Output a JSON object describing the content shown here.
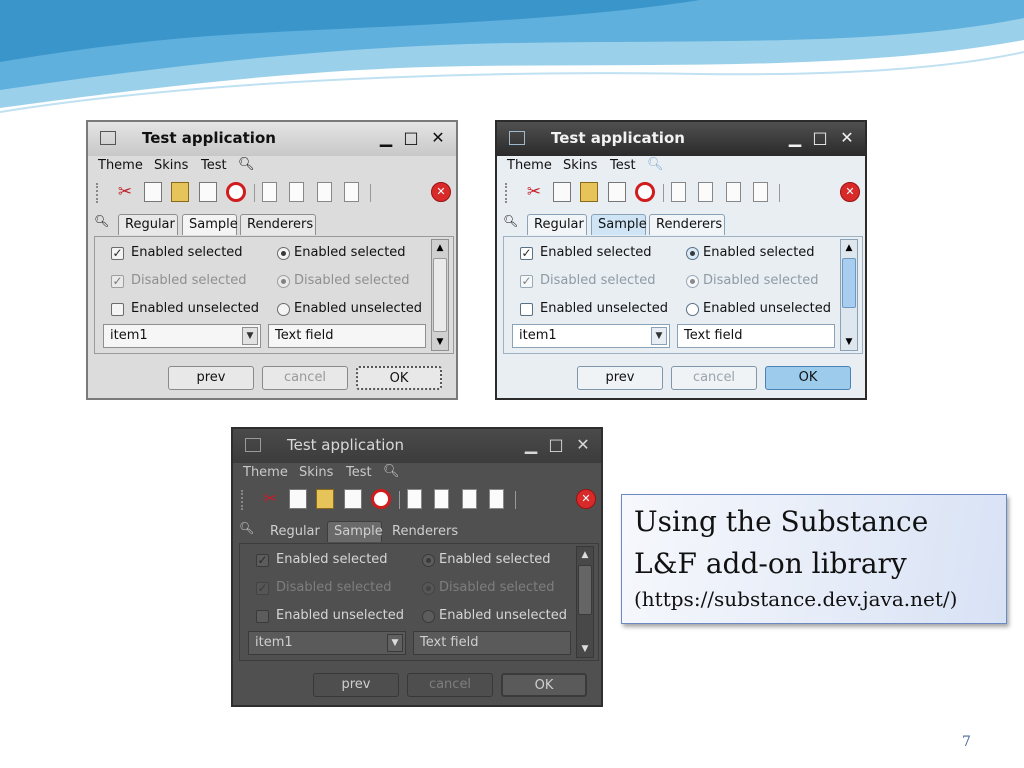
{
  "windows": [
    {
      "title": "Test application",
      "menu": [
        "Theme",
        "Skins",
        "Test"
      ],
      "tabs": [
        "Regular",
        "Sample",
        "Renderers"
      ],
      "check_enabled_selected": "Enabled selected",
      "check_disabled_selected": "Disabled selected",
      "check_enabled_unselected": "Enabled unselected",
      "radio_enabled_selected": "Enabled selected",
      "radio_disabled_selected": "Disabled selected",
      "radio_enabled_unselected": "Enabled unselected",
      "combo_value": "item1",
      "text_field": "Text field",
      "prev": "prev",
      "cancel": "cancel",
      "ok": "OK"
    },
    {
      "title": "Test application",
      "menu": [
        "Theme",
        "Skins",
        "Test"
      ],
      "tabs": [
        "Regular",
        "Sample",
        "Renderers"
      ],
      "check_enabled_selected": "Enabled selected",
      "check_disabled_selected": "Disabled selected",
      "check_enabled_unselected": "Enabled unselected",
      "radio_enabled_selected": "Enabled selected",
      "radio_disabled_selected": "Disabled selected",
      "radio_enabled_unselected": "Enabled unselected",
      "combo_value": "item1",
      "text_field": "Text field",
      "prev": "prev",
      "cancel": "cancel",
      "ok": "OK"
    },
    {
      "title": "Test application",
      "menu": [
        "Theme",
        "Skins",
        "Test"
      ],
      "tabs": [
        "Regular",
        "Sample",
        "Renderers"
      ],
      "check_enabled_selected": "Enabled selected",
      "check_disabled_selected": "Disabled selected",
      "check_enabled_unselected": "Enabled unselected",
      "radio_enabled_selected": "Enabled selected",
      "radio_disabled_selected": "Disabled selected",
      "radio_enabled_unselected": "Enabled unselected",
      "combo_value": "item1",
      "text_field": "Text field",
      "prev": "prev",
      "cancel": "cancel",
      "ok": "OK"
    }
  ],
  "callout": {
    "line1": "Using the Substance",
    "line2": "L&F add-on library",
    "line3": "(https://substance.dev.java.net/)"
  },
  "page_number": "7",
  "colors": {
    "wave_light": "#cfe7f3",
    "wave_mid": "#8cc6e4",
    "wave_dark": "#3f9bd0",
    "callout_border": "#6b89c2"
  }
}
